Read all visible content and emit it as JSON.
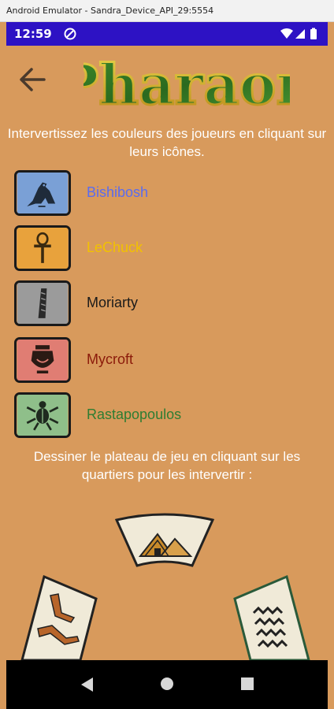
{
  "emulator": {
    "title": "Android Emulator - Sandra_Device_API_29:5554"
  },
  "status_bar": {
    "time": "12:59"
  },
  "header": {
    "logo_text": "Pharaon"
  },
  "instructions": {
    "players": "Intervertissez les couleurs des joueurs en cliquant sur leurs icônes.",
    "board": "Dessiner le plateau de jeu en cliquant sur les quartiers pour les intervertir :"
  },
  "players": [
    {
      "name": "Bishibosh",
      "color": "#5a6cf0",
      "icon": "falcon-icon",
      "tile_color": "#7aa0d6"
    },
    {
      "name": "LeChuck",
      "color": "#f2c200",
      "icon": "ankh-icon",
      "tile_color": "#e8a23c"
    },
    {
      "name": "Moriarty",
      "color": "#1a1a1a",
      "icon": "feather-icon",
      "tile_color": "#9b9b9b"
    },
    {
      "name": "Mycroft",
      "color": "#8b1a0a",
      "icon": "vase-icon",
      "tile_color": "#e07d73"
    },
    {
      "name": "Rastapopoulos",
      "color": "#2e7d32",
      "icon": "scarab-icon",
      "tile_color": "#8fbf8a"
    }
  ],
  "board_tiles": [
    "pyramid-tile",
    "legs-tile",
    "water-tile"
  ],
  "colors": {
    "background": "#d89a5c",
    "status_bar": "#2d12c4",
    "nav_bar": "#000000"
  }
}
